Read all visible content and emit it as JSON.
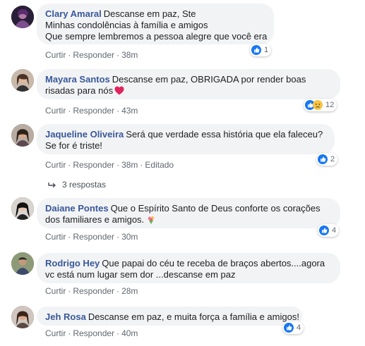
{
  "comments": [
    {
      "author": "Clary Amaral",
      "lines": [
        "Descanse em paz, Ste",
        "Minhas condolências à família e amigos",
        "Que sempre lembremos a pessoa alegre que você era"
      ],
      "like_label": "Curtir",
      "reply_label": "Responder",
      "time": "38m",
      "reactions": {
        "icons": [
          "like-icon"
        ],
        "count": "1"
      }
    },
    {
      "author": "Mayara Santos",
      "lines": [
        "Descanse em paz, OBRIGADA por render boas",
        "risadas para nós"
      ],
      "emoji": "red-heart-icon",
      "like_label": "Curtir",
      "reply_label": "Responder",
      "time": "43m",
      "reactions": {
        "icons": [
          "like-icon",
          "sad-icon"
        ],
        "count": "12"
      }
    },
    {
      "author": "Jaqueline Oliveira",
      "lines": [
        "Será que verdade essa história que ela faleceu?",
        "Se for é triste!"
      ],
      "like_label": "Curtir",
      "reply_label": "Responder",
      "time": "38m",
      "edited_label": "Editado",
      "reactions": {
        "icons": [
          "like-icon"
        ],
        "count": "2"
      },
      "replies_label": "3 respostas"
    },
    {
      "author": "Daiane Pontes",
      "lines": [
        "Que o Espírito Santo de Deus conforte os corações",
        "dos familiares e amigos."
      ],
      "emoji": "bouquet-icon",
      "like_label": "Curtir",
      "reply_label": "Responder",
      "time": "30m",
      "reactions": {
        "icons": [
          "like-icon"
        ],
        "count": "4"
      }
    },
    {
      "author": "Rodrigo Hey",
      "lines": [
        "Que papai do céu te receba de braços abertos....agora",
        "vc está num lugar sem dor ...descanse em paz"
      ],
      "like_label": "Curtir",
      "reply_label": "Responder",
      "time": "28m"
    },
    {
      "author": "Jeh Rosa",
      "lines": [
        "Descanse em paz, e muita força a família e amigos!"
      ],
      "like_label": "Curtir",
      "reply_label": "Responder",
      "time": "40m",
      "reactions": {
        "icons": [
          "like-icon"
        ],
        "count": "4"
      }
    }
  ],
  "colors": {
    "author": "#385898",
    "bubble": "#f2f3f5",
    "meta": "#616770",
    "like_blue": "#1877f2",
    "heart_red": "#e0245e"
  }
}
